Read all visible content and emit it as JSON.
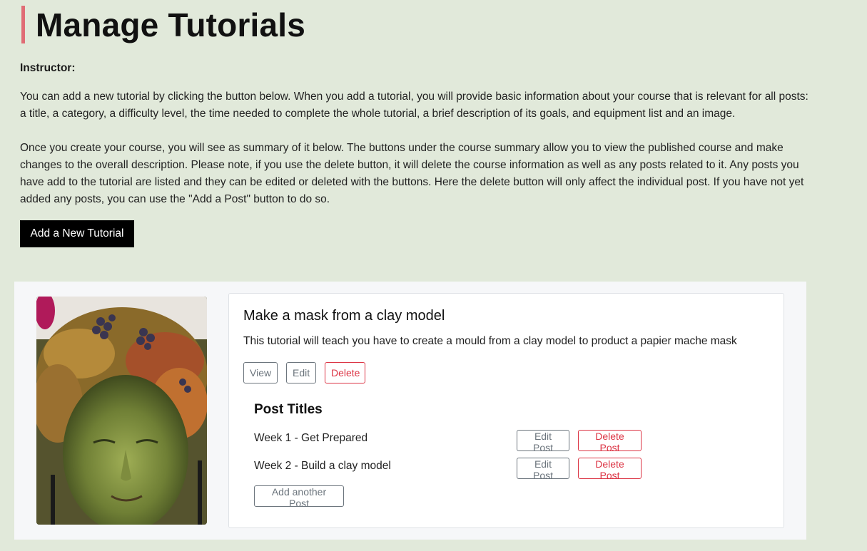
{
  "page": {
    "title": "Manage Tutorials",
    "instructor_label": "Instructor:",
    "intro_paragraphs": [
      "You can add a new tutorial by clicking the button below. When you add a tutorial, you will provide basic information about your course that is relevant for all posts: a title, a category, a difficulty level, the time needed to complete the whole tutorial, a brief description of its goals, and equipment list and an image.",
      "Once you create your course, you will see as summary of it below. The buttons under the course summary allow you to view the published course and make changes to the overall description. Please note, if you use the delete button, it will delete the course information as well as any posts related to it. Any posts you have add to the tutorial are listed and they can be edited or deleted with the buttons. Here the delete button will only affect the individual post. If you have not yet added any posts, you can use the \"Add a Post\" button to do so."
    ],
    "add_tutorial_label": "Add a New Tutorial"
  },
  "tutorial": {
    "image_icon": "clay-mask-photo",
    "title": "Make a mask from a clay model",
    "description": "This tutorial will teach you have to create a mould from a clay model to product a papier mache mask",
    "view_label": "View",
    "edit_label": "Edit",
    "delete_label": "Delete",
    "posts_heading": "Post Titles",
    "posts": [
      {
        "title": "Week 1 - Get Prepared",
        "edit_label": "Edit Post",
        "delete_label": "Delete Post"
      },
      {
        "title": "Week 2 - Build a clay model",
        "edit_label": "Edit Post",
        "delete_label": "Delete Post"
      }
    ],
    "add_post_label": "Add another Post"
  },
  "colors": {
    "background": "#e1e9da",
    "heading_accent": "#e06c75",
    "danger": "#dc3545",
    "secondary": "#6c757d"
  }
}
